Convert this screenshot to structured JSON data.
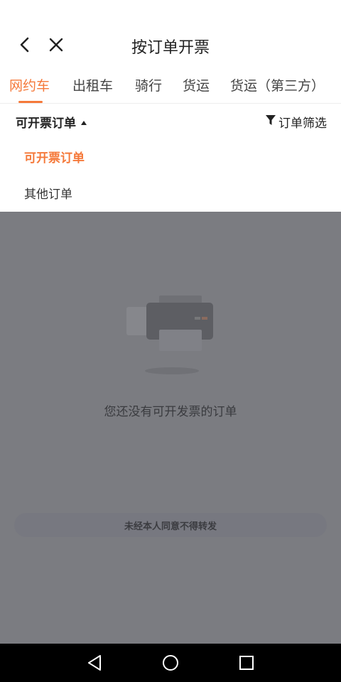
{
  "header": {
    "title": "按订单开票"
  },
  "tabs": [
    {
      "label": "网约车",
      "active": true
    },
    {
      "label": "出租车",
      "active": false
    },
    {
      "label": "骑行",
      "active": false
    },
    {
      "label": "货运",
      "active": false
    },
    {
      "label": "货运（第三方）",
      "active": false
    }
  ],
  "filter": {
    "dropdown_label": "可开票订单",
    "filter_label": "订单筛选"
  },
  "dropdown": {
    "options": [
      {
        "label": "可开票订单",
        "selected": true
      },
      {
        "label": "其他订单",
        "selected": false
      }
    ]
  },
  "empty_state": {
    "message": "您还没有可开发票的订单",
    "icon": "printer-icon"
  },
  "notice": {
    "text": "未经本人同意不得转发"
  },
  "colors": {
    "accent": "#f5793a",
    "overlay": "#7b7c81"
  }
}
